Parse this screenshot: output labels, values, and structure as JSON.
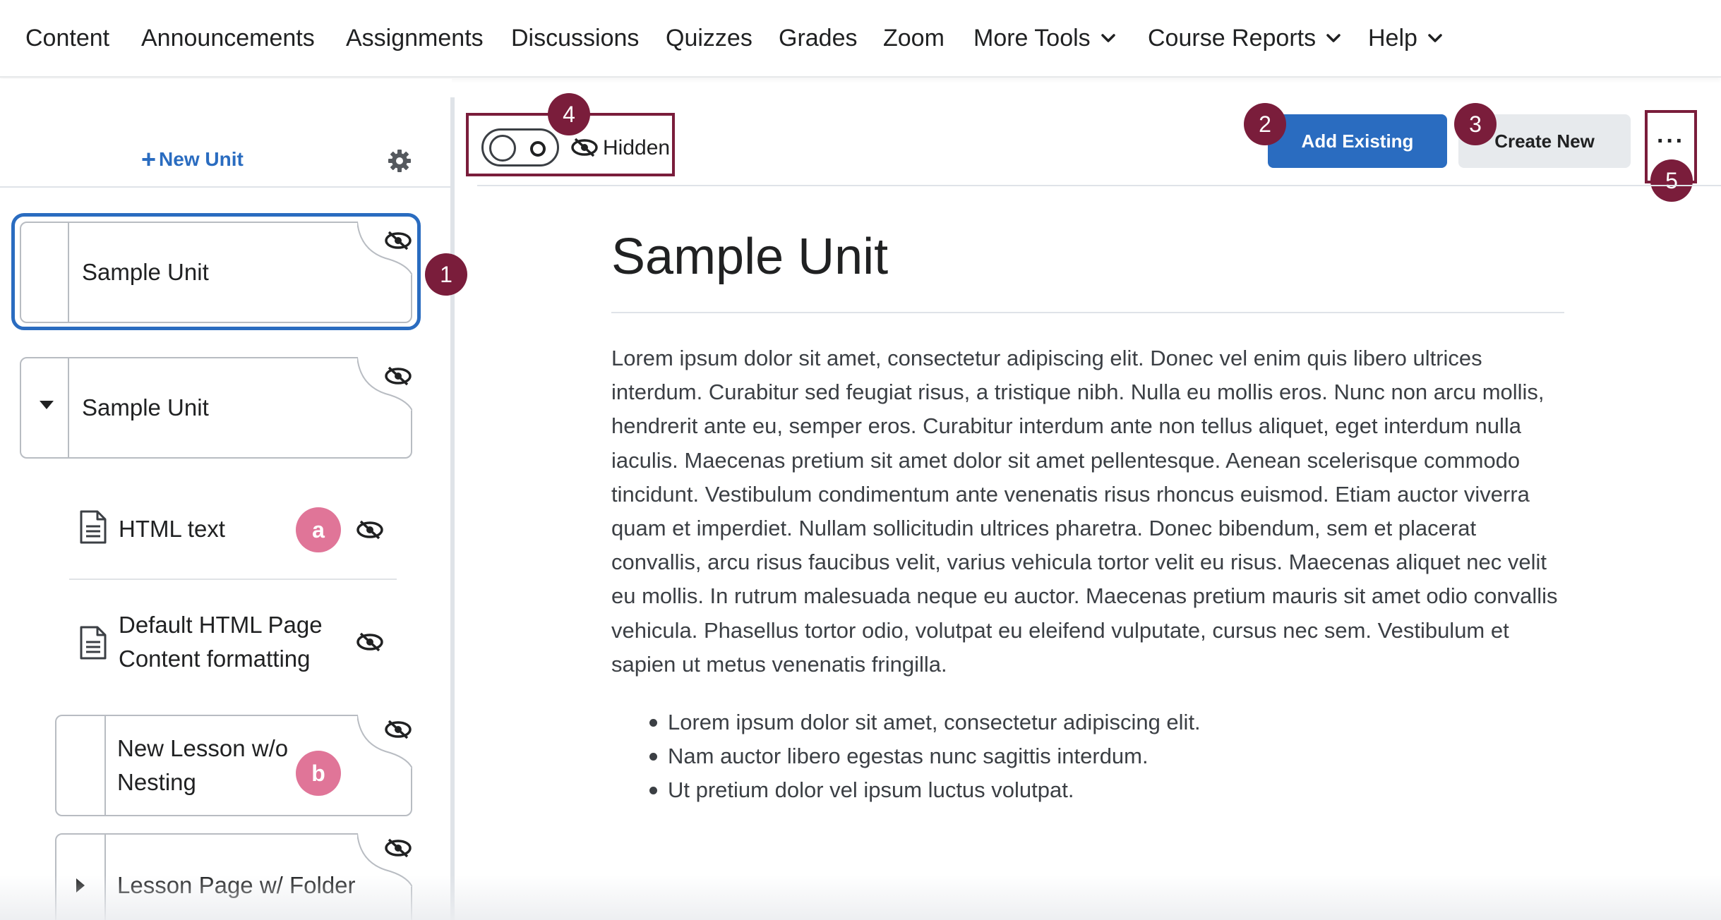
{
  "nav": {
    "items": [
      {
        "label": "Content"
      },
      {
        "label": "Announcements"
      },
      {
        "label": "Assignments"
      },
      {
        "label": "Discussions"
      },
      {
        "label": "Quizzes"
      },
      {
        "label": "Grades"
      },
      {
        "label": "Zoom"
      },
      {
        "label": "More Tools"
      },
      {
        "label": "Course Reports"
      },
      {
        "label": "Help"
      }
    ]
  },
  "sidebar": {
    "new_unit_label": "New Unit",
    "units": [
      {
        "label": "Sample Unit",
        "hidden": true,
        "selected": true
      },
      {
        "label": "Sample Unit",
        "hidden": true,
        "expanded": true
      }
    ],
    "topics": [
      {
        "label": "HTML text",
        "hidden": true
      },
      {
        "label_line1": "Default HTML Page",
        "label_line2": "Content formatting",
        "hidden": true
      }
    ],
    "lessons": [
      {
        "label_line1": "New Lesson w/o",
        "label_line2": "Nesting",
        "hidden": true
      },
      {
        "label": "Lesson Page w/ Folder",
        "hidden": true,
        "collapsed": true
      }
    ]
  },
  "toolbar": {
    "visibility_label": "Hidden",
    "add_existing_label": "Add Existing",
    "create_new_label": "Create New",
    "more_label": "···"
  },
  "callouts": {
    "one": "1",
    "two": "2",
    "three": "3",
    "four": "4",
    "five": "5",
    "a": "a",
    "b": "b",
    "accent_color": "#7a1d3b",
    "pink_color": "#e07598"
  },
  "main": {
    "title": "Sample Unit",
    "paragraph": "Lorem ipsum dolor sit amet, consectetur adipiscing elit. Donec vel enim quis libero ultrices interdum. Curabitur sed feugiat risus, a tristique nibh. Nulla eu mollis eros. Nunc non arcu mollis, hendrerit ante eu, semper eros. Curabitur interdum ante non tellus aliquet, eget interdum nulla iaculis. Maecenas pretium sit amet dolor sit amet pellentesque. Aenean scelerisque commodo tincidunt. Vestibulum condimentum ante venenatis risus rhoncus euismod. Etiam auctor viverra quam et imperdiet. Nullam sollicitudin ultrices pharetra. Donec bibendum, sem et placerat convallis, arcu risus faucibus velit, varius vehicula tortor velit eu risus. Maecenas aliquet nec velit eu mollis. In rutrum malesuada neque eu auctor. Maecenas pretium mauris sit amet odio convallis vehicula. Phasellus tortor odio, volutpat eu eleifend vulputate, cursus nec sem. Vestibulum et sapien ut metus venenatis fringilla.",
    "bullets": [
      "Lorem ipsum dolor sit amet, consectetur adipiscing elit.",
      "Nam auctor libero egestas nunc sagittis interdum.",
      "Ut pretium dolor vel ipsum luctus volutpat."
    ]
  },
  "colors": {
    "primary": "#2a6cc0",
    "text": "#202122",
    "border": "#b8bcc2"
  }
}
